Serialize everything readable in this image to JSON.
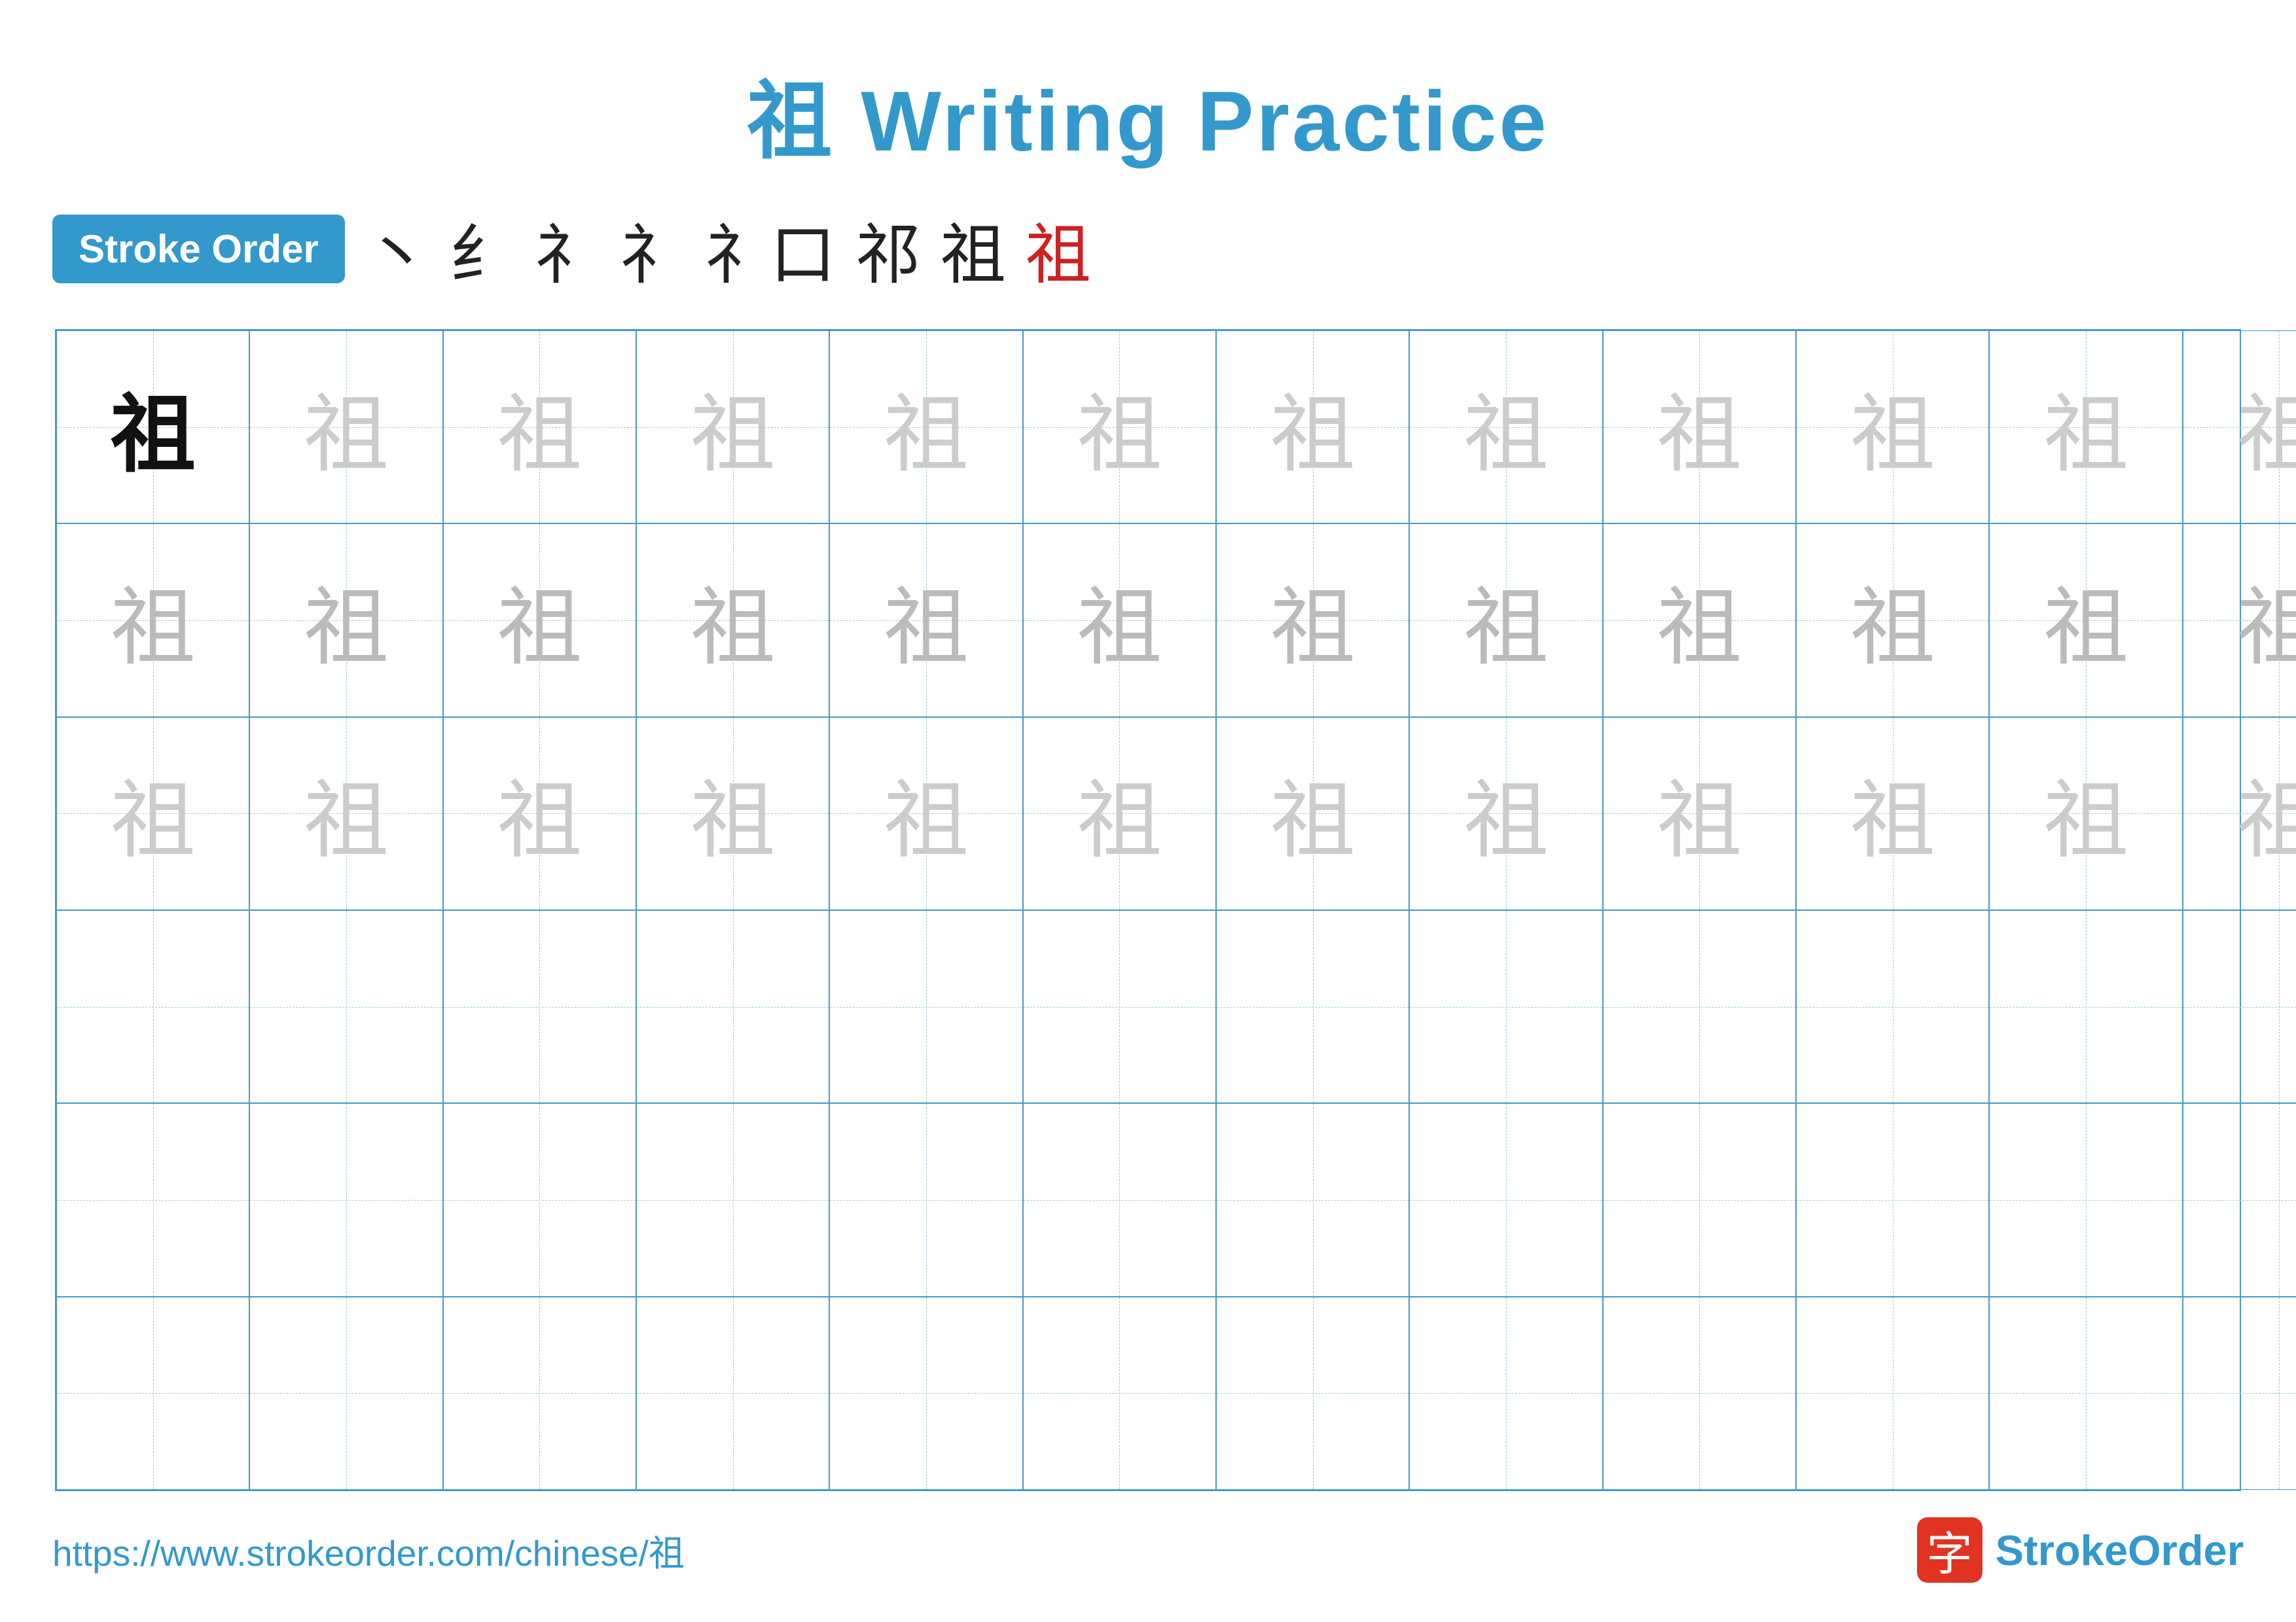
{
  "title": {
    "chinese_char": "祖",
    "rest": " Writing Practice"
  },
  "stroke_order": {
    "badge_label": "Stroke Order",
    "strokes": [
      {
        "char": "丶",
        "style": "dark"
      },
      {
        "char": "纟",
        "style": "dark"
      },
      {
        "char": "礻",
        "style": "dark"
      },
      {
        "char": "礻l",
        "style": "dark"
      },
      {
        "char": "礻口",
        "style": "dark"
      },
      {
        "char": "祁",
        "style": "dark"
      },
      {
        "char": "祖",
        "style": "dark"
      },
      {
        "char": "祖",
        "style": "red"
      }
    ]
  },
  "grid": {
    "columns": 13,
    "rows": 6,
    "character": "祖",
    "cells": {
      "row0_col0": "bold",
      "row0_rest": "light",
      "row1_all": "medium",
      "row2_all": "light",
      "row3_all": "empty",
      "row4_all": "empty",
      "row5_all": "empty"
    }
  },
  "footer": {
    "url": "https://www.strokeorder.com/chinese/祖",
    "logo_char": "字",
    "logo_name": "StrokeOrder"
  },
  "colors": {
    "blue": "#3399cc",
    "red": "#cc2222",
    "dark": "#111111",
    "light_gray": "#cccccc",
    "medium_gray": "#bbbbbb",
    "logo_red": "#e03322"
  }
}
